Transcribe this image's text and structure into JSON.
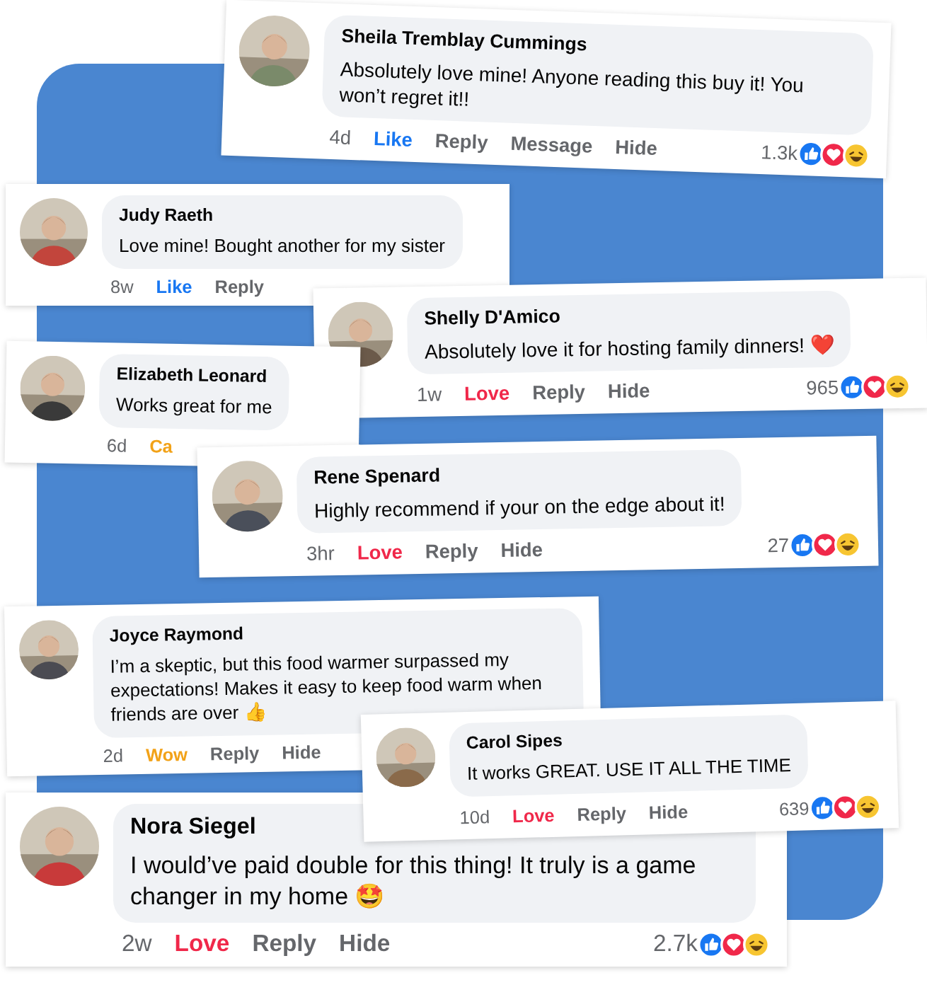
{
  "comments": [
    {
      "name": "Sheila Tremblay Cummings",
      "text": "Absolutely love mine! Anyone reading this buy it! You won’t regret it!!",
      "time": "4d",
      "reaction": {
        "label": "Like",
        "kind": "like"
      },
      "actions": [
        "Reply",
        "Message",
        "Hide"
      ],
      "count": "1.3k"
    },
    {
      "name": "Judy Raeth",
      "text": "Love mine! Bought another for my sister",
      "time": "8w",
      "reaction": {
        "label": "Like",
        "kind": "like"
      },
      "actions": [
        "Reply"
      ]
    },
    {
      "name": "Shelly D'Amico",
      "text": "Absolutely love it for hosting family dinners! ❤️",
      "time": "1w",
      "reaction": {
        "label": "Love",
        "kind": "love"
      },
      "actions": [
        "Reply",
        "Hide"
      ],
      "count": "965"
    },
    {
      "name": "Elizabeth Leonard",
      "text": "Works great for me",
      "time": "6d",
      "reaction": {
        "label": "Ca",
        "kind": "care"
      }
    },
    {
      "name": "Rene Spenard",
      "text": "Highly recommend if your on the edge about it!",
      "time": "3hr",
      "reaction": {
        "label": "Love",
        "kind": "love"
      },
      "actions": [
        "Reply",
        "Hide"
      ],
      "count": "27"
    },
    {
      "name": "Joyce Raymond",
      "text": "I’m a skeptic, but this food warmer surpassed my expectations! Makes it easy to keep food warm when friends are over 👍",
      "time": "2d",
      "reaction": {
        "label": "Wow",
        "kind": "wow"
      },
      "actions": [
        "Reply",
        "Hide"
      ]
    },
    {
      "name": "Carol Sipes",
      "text": "It works GREAT. USE IT ALL THE TIME",
      "time": "10d",
      "reaction": {
        "label": "Love",
        "kind": "love"
      },
      "actions": [
        "Reply",
        "Hide"
      ],
      "count": "639"
    },
    {
      "name": "Nora Siegel",
      "text": "I would’ve paid double for this thing! It truly is a game changer in my home 🤩",
      "time": "2w",
      "reaction": {
        "label": "Love",
        "kind": "love"
      },
      "actions": [
        "Reply",
        "Hide"
      ],
      "count": "2.7k"
    }
  ]
}
